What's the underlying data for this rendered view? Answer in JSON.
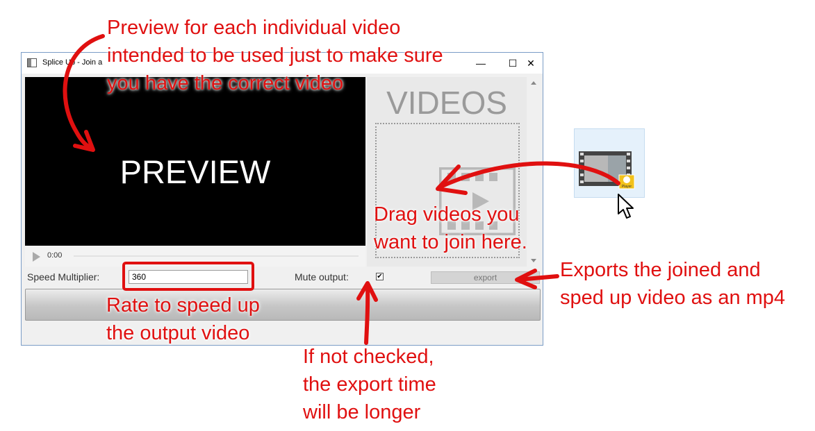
{
  "window": {
    "title": "Splice Up - Join a",
    "minimize_glyph": "—",
    "maximize_glyph": "☐",
    "close_glyph": "✕"
  },
  "preview": {
    "label": "PREVIEW",
    "time": "0:00",
    "playback_progress": 0
  },
  "videos_panel": {
    "title": "VIDEOS"
  },
  "controls": {
    "speed_label": "Speed Multiplier:",
    "speed_value": "360",
    "mute_label": "Mute output:",
    "mute_checked": true,
    "mute_glyph": "✔",
    "export_label": "export"
  },
  "desktop_file": {
    "badge": "Player"
  },
  "annotations": {
    "preview_note_lines": [
      "Preview for each individual video",
      "intended to be used just to make sure",
      "you have the correct video"
    ],
    "drag_note_lines": [
      "Drag videos you",
      "want to join here."
    ],
    "export_note_lines": [
      "Exports the joined and",
      "sped up video as an mp4"
    ],
    "speed_note_lines": [
      "Rate to speed up",
      "the output video"
    ],
    "mute_note_lines": [
      "If not checked,",
      "the export time",
      "will be longer"
    ],
    "color": "#e01010"
  }
}
